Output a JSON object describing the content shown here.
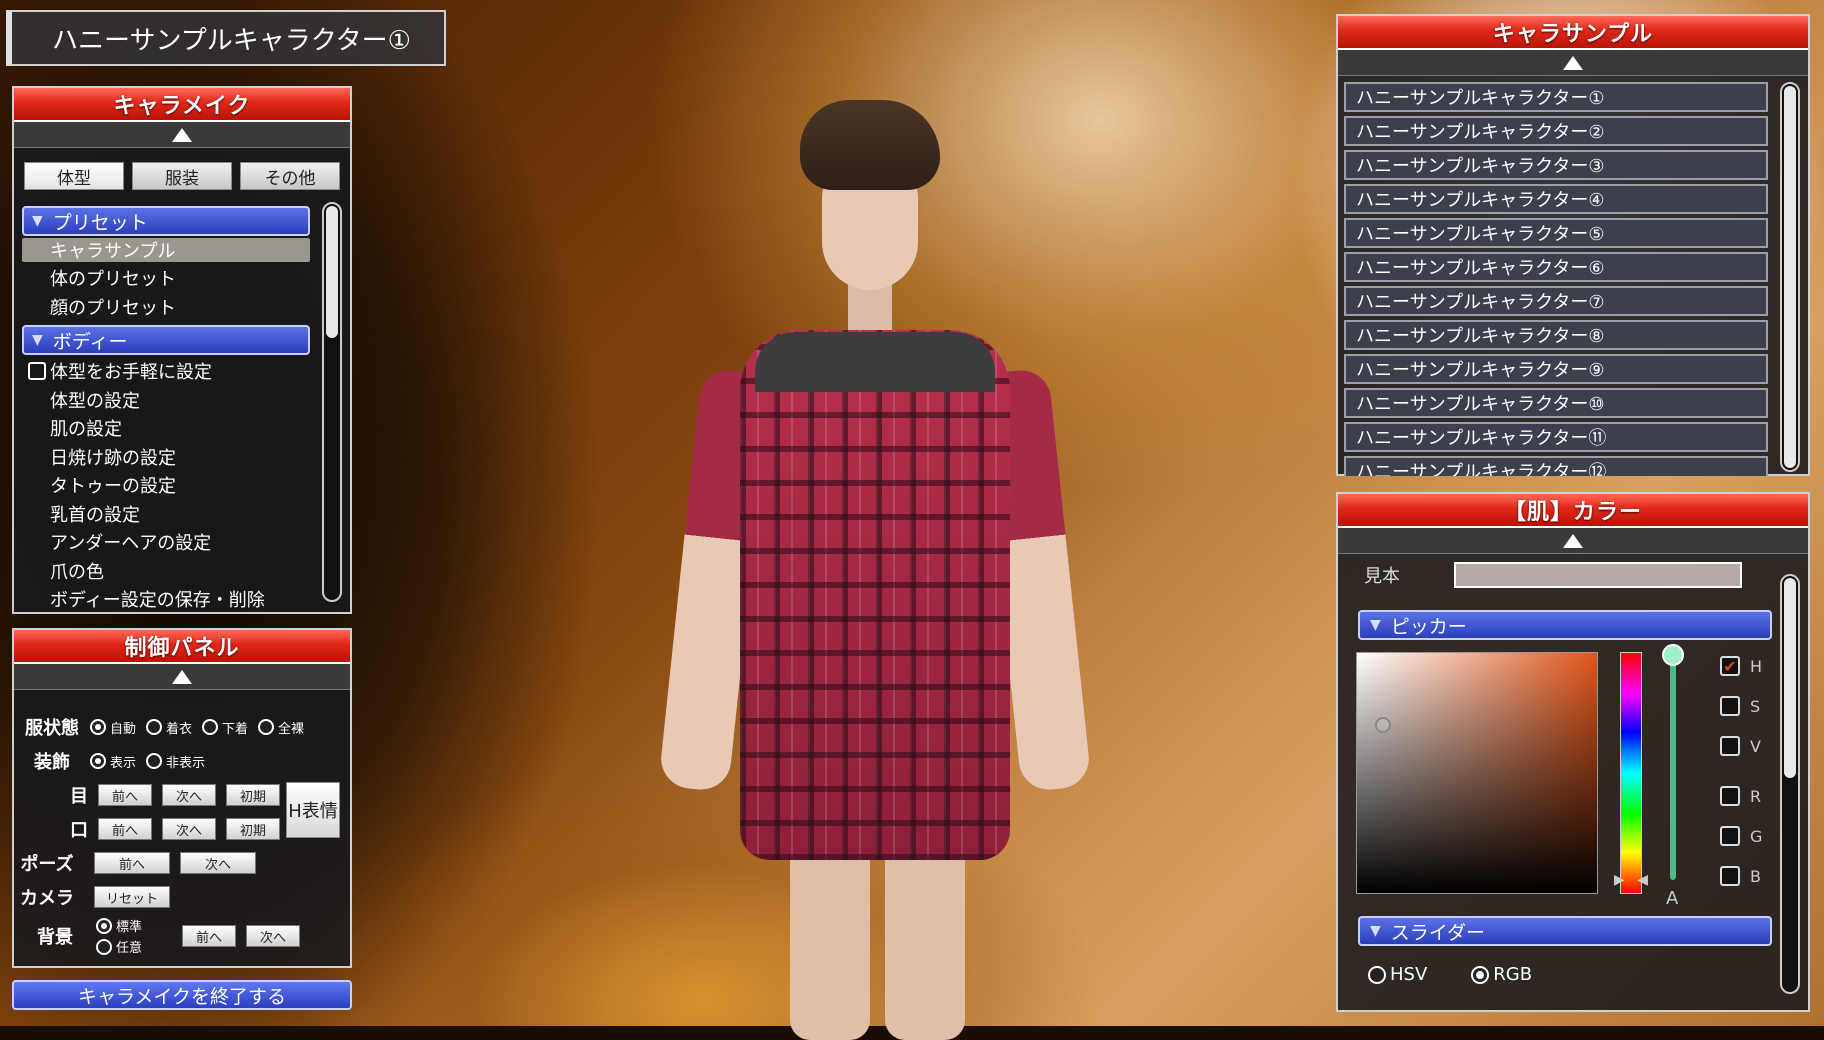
{
  "title": "ハニーサンプルキャラクター①",
  "chara_make": {
    "header": "キャラメイク",
    "tabs": [
      "体型",
      "服装",
      "その他"
    ],
    "sections": [
      {
        "label": "プリセット",
        "items": [
          "キャラサンプル",
          "体のプリセット",
          "顔のプリセット"
        ]
      },
      {
        "label": "ボディー",
        "items": [
          "体型をお手軽に設定",
          "体型の設定",
          "肌の設定",
          "日焼け跡の設定",
          "タトゥーの設定",
          "乳首の設定",
          "アンダーヘアの設定",
          "爪の色",
          "ボディー設定の保存・削除"
        ]
      }
    ],
    "selected_item": "キャラサンプル"
  },
  "control_panel": {
    "header": "制御パネル",
    "clothing_state": {
      "label": "服状態",
      "options": [
        "自動",
        "着衣",
        "下着",
        "全裸"
      ],
      "selected": "自動"
    },
    "accessory": {
      "label": "装飾",
      "options": [
        "表示",
        "非表示"
      ],
      "selected": "表示"
    },
    "eyes": {
      "label": "目",
      "buttons": [
        "前へ",
        "次へ",
        "初期"
      ]
    },
    "mouth": {
      "label": "口",
      "buttons": [
        "前へ",
        "次へ",
        "初期"
      ]
    },
    "h_expression": "H表情",
    "pose": {
      "label": "ポーズ",
      "buttons": [
        "前へ",
        "次へ"
      ]
    },
    "camera": {
      "label": "カメラ",
      "button": "リセット"
    },
    "background": {
      "label": "背景",
      "options": [
        "標準",
        "任意"
      ],
      "selected": "標準",
      "buttons": [
        "前へ",
        "次へ"
      ]
    }
  },
  "exit_button": "キャラメイクを終了する",
  "sample_panel": {
    "header": "キャラサンプル",
    "items": [
      "ハニーサンプルキャラクター①",
      "ハニーサンプルキャラクター②",
      "ハニーサンプルキャラクター③",
      "ハニーサンプルキャラクター④",
      "ハニーサンプルキャラクター⑤",
      "ハニーサンプルキャラクター⑥",
      "ハニーサンプルキャラクター⑦",
      "ハニーサンプルキャラクター⑧",
      "ハニーサンプルキャラクター⑨",
      "ハニーサンプルキャラクター⑩",
      "ハニーサンプルキャラクター⑪",
      "ハニーサンプルキャラクター⑫"
    ]
  },
  "color_panel": {
    "header": "【肌】カラー",
    "sample_label": "見本",
    "sample_color": "#b6aaa5",
    "picker_label": "ピッカー",
    "alpha_label": "A",
    "channels": [
      "H",
      "S",
      "V",
      "R",
      "G",
      "B"
    ],
    "channel_checked": "H",
    "slider_label": "スライダー",
    "modes": [
      "HSV",
      "RGB"
    ],
    "selected_mode": "RGB"
  }
}
